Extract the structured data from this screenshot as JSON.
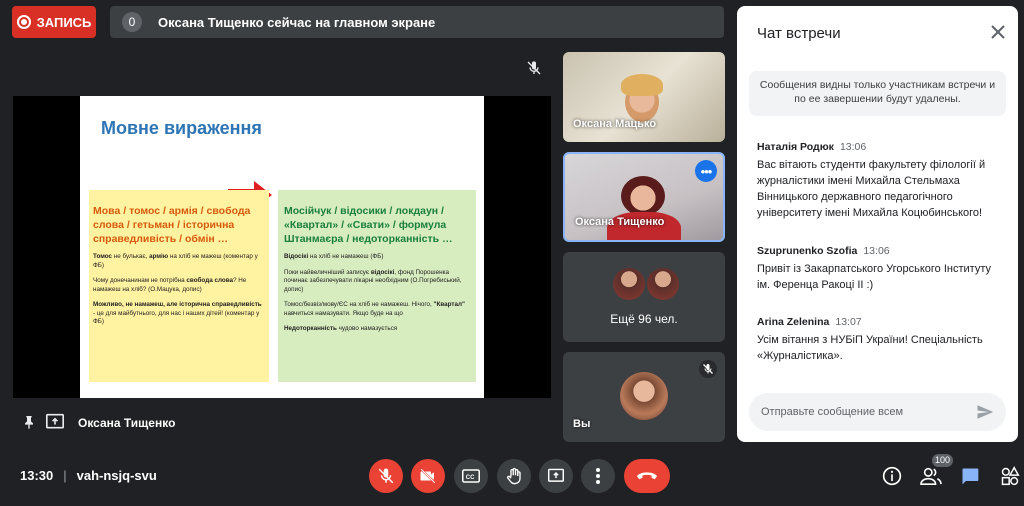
{
  "top_bar": {
    "record_label": "ЗАПИСЬ",
    "notice_badge": "0",
    "notice_text": "Оксана Тищенко сейчас на главном экране"
  },
  "slide": {
    "title": "Мовне вираження",
    "left_heading": "Мова / томос / армія / свобода слова / гетьман / історична справедливість / обмін …",
    "left_paragraphs": [
      [
        "Томос",
        " не булькає, ",
        "армію",
        " на хліб не мажеш (коментар у ФБ)"
      ],
      [
        "Чому донечанинам не потрібна ",
        "свобода слова",
        "? Не намажеш на хліб? (О.Мацука, допис)"
      ],
      [
        "Можливо, не ",
        "намажеш",
        ", але ",
        "історична справедливість",
        " - це для майбутнього, для нас і наших дітей! (коментар у ФБ)"
      ]
    ],
    "right_heading": "Мосійчук / відосики / локдаун / «Квартал» / «Свати» / формула Штанмаєра / недоторканність …",
    "right_paragraphs": [
      [
        "Відосікі",
        " на хліб не намажеш (ФБ)"
      ],
      [
        "Поки найвеличніший записує ",
        "відосікі",
        ", фонд Порошенка починає забезпечувати лікарні необхідним (О.Погребиський, допис)"
      ],
      [
        "Томос/безвіз/мову/ЄС на хліб не намажеш. Нічого, ",
        "\"Квартал\"",
        " навчиться намазувати. Якщо буде на що"
      ],
      [
        "Недоторканність",
        " чудово намазується"
      ]
    ]
  },
  "presenter": {
    "name": "Оксана Тищенко"
  },
  "tiles": {
    "tile1_name": "Оксана Мацько",
    "tile2_name": "Оксана Тищенко",
    "tile2_more": "•••",
    "tile3_label": "Ещё 96 чел.",
    "tile4_name": "Вы"
  },
  "chat": {
    "title": "Чат встречи",
    "info": "Сообщения видны только участникам встречи и по ее завершении будут удалены.",
    "messages": [
      {
        "author": "Наталія Родюк",
        "time": "13:06",
        "text": "Вас вітають студенти факультету філології й журналістики імені Михайла Стельмаха Вінницького державного педагогічного університету імені Михайла Коцюбинського!"
      },
      {
        "author": "Szuprunenko Szofia",
        "time": "13:06",
        "text": "Привіт із Закарпатського Угорського Інституту ім. Ференца Ракоці ІІ :)"
      },
      {
        "author": "Arina Zelenina",
        "time": "13:07",
        "text": "Усім вітання з НУБіП України! Спеціальність «Журналістика»."
      }
    ],
    "input_placeholder": "Отправьте сообщение всем"
  },
  "bottom_bar": {
    "time": "13:30",
    "separator": "|",
    "meeting_code": "vah-nsjq-svu",
    "participants_count": "100"
  },
  "colors": {
    "record_red": "#d93025",
    "control_red": "#ea4335",
    "active_tile_border": "#8ab4f8",
    "accent_blue": "#1a73e8"
  }
}
